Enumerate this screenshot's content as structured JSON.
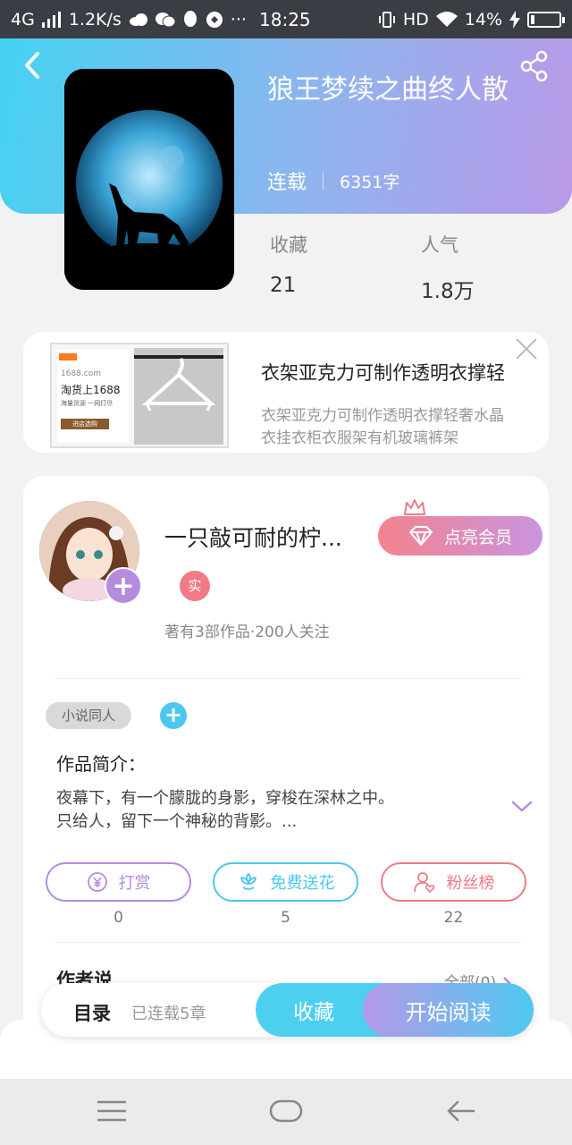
{
  "status_bar": {
    "network": "4G",
    "speed": "1.2K/s",
    "time": "18:25",
    "hd": "HD",
    "battery": "14%",
    "battery_level": 0.14
  },
  "book": {
    "title": "狼王梦续之曲终人散",
    "status": "连载",
    "word_count": "6351字",
    "stats": [
      {
        "label": "收藏",
        "value": "21"
      },
      {
        "label": "人气",
        "value": "1.8万"
      }
    ]
  },
  "ad": {
    "title": "衣架亚克力可制作透明衣撑轻",
    "description_line1": "衣架亚克力可制作透明衣撑轻奢水晶",
    "description_line2": "衣挂衣柜衣服架有机玻璃裤架",
    "image_brand": "1688.com",
    "image_headline": "淘货上1688",
    "image_sub": "海量货源 一网打尽",
    "image_button": "进店选购"
  },
  "author": {
    "name": "一只敲可耐的柠...",
    "badge": "实",
    "stats": "著有3部作品·200人关注",
    "vip_label": "点亮会员"
  },
  "tags": [
    "小说同人"
  ],
  "intro": {
    "title": "作品简介：",
    "line1": "夜幕下，有一个朦胧的身影，穿梭在深林之中。",
    "line2": "只给人，留下一个神秘的背影。..."
  },
  "actions": [
    {
      "label": "打赏",
      "count": "0",
      "color": "#b48be0",
      "icon": "yen-icon"
    },
    {
      "label": "免费送花",
      "count": "5",
      "color": "#4cc8ee",
      "icon": "flower-icon"
    },
    {
      "label": "粉丝榜",
      "count": "22",
      "color": "#f07a85",
      "icon": "fans-icon"
    }
  ],
  "author_says": {
    "title": "作者说",
    "all_link": "全部(0)"
  },
  "bottom_bar": {
    "toc": "目录",
    "chapters": "已连载5章",
    "favorite": "收藏",
    "read": "开始阅读"
  },
  "colors": {
    "cyan": "#4dd0f0",
    "purple": "#b599e8",
    "pink": "#f07a85"
  }
}
